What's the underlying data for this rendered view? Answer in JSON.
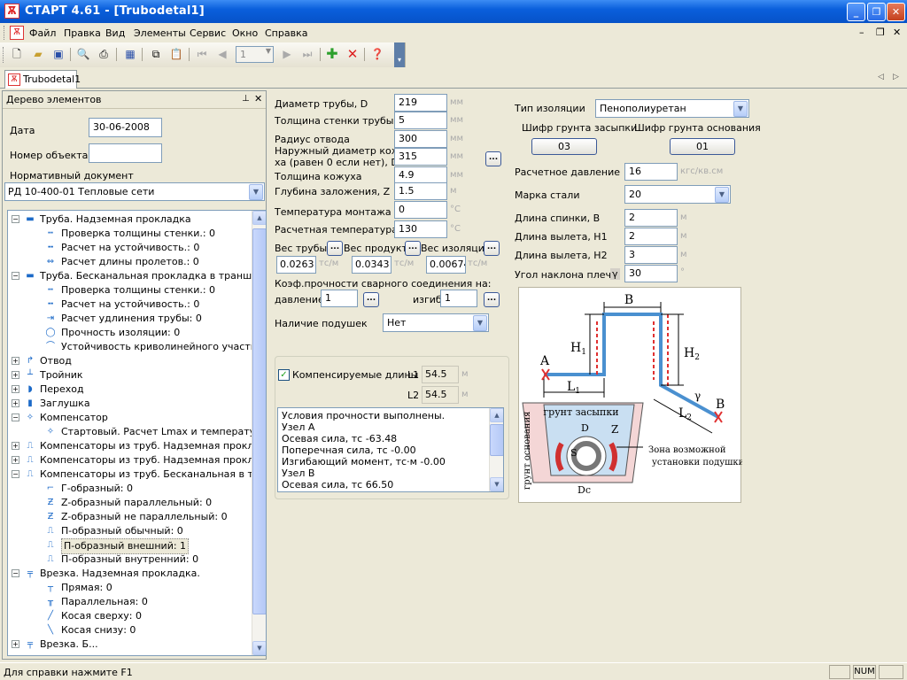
{
  "window": {
    "title": "СТАРТ 4.61 - [Trubodetal1]",
    "app_icon_glyph": "Ѫ"
  },
  "menu": [
    "Файл",
    "Правка",
    "Вид",
    "Элементы",
    "Сервис",
    "Окно",
    "Справка"
  ],
  "toolbar": {
    "page_value": "1"
  },
  "doc_tab": "Trubodetal1",
  "panel": {
    "title": "Дерево элементов",
    "date_label": "Дата",
    "date_value": "30-06-2008",
    "object_label": "Номер объекта",
    "object_value": "",
    "norm_label": "Нормативный документ",
    "norm_value": "РД 10-400-01 Тепловые сети"
  },
  "tree": [
    {
      "level": 0,
      "exp": "−",
      "icon": "▬",
      "text": "Труба. Надземная прокладка"
    },
    {
      "level": 1,
      "icon": "┅",
      "text": "Проверка толщины стенки.: 0"
    },
    {
      "level": 1,
      "icon": "╍",
      "text": "Расчет на устойчивость.: 0"
    },
    {
      "level": 1,
      "icon": "⇔",
      "text": "Расчет длины пролетов.: 0"
    },
    {
      "level": 0,
      "exp": "−",
      "icon": "▬",
      "text": "Труба. Бесканальная прокладка в траншее"
    },
    {
      "level": 1,
      "icon": "┅",
      "text": "Проверка толщины стенки.: 0"
    },
    {
      "level": 1,
      "icon": "╍",
      "text": "Расчет на устойчивость.: 0"
    },
    {
      "level": 1,
      "icon": "⇥",
      "text": "Расчет удлинения трубы: 0"
    },
    {
      "level": 1,
      "icon": "◯",
      "text": "Прочность изоляции: 0"
    },
    {
      "level": 1,
      "icon": "⌒",
      "text": "Устойчивость криволинейного участка: 0"
    },
    {
      "level": 0,
      "exp": "+",
      "icon": "↱",
      "text": "Отвод"
    },
    {
      "level": 0,
      "exp": "+",
      "icon": "┴",
      "text": "Тройник"
    },
    {
      "level": 0,
      "exp": "+",
      "icon": "◗",
      "text": "Переход"
    },
    {
      "level": 0,
      "exp": "+",
      "icon": "▮",
      "text": "Заглушка"
    },
    {
      "level": 0,
      "exp": "−",
      "icon": "✧",
      "text": "Компенсатор"
    },
    {
      "level": 1,
      "icon": "✧",
      "text": "Стартовый. Расчет Lmax и температуры з"
    },
    {
      "level": 0,
      "exp": "+",
      "icon": "⎍",
      "text": "Компенсаторы из труб. Надземная прокладк"
    },
    {
      "level": 0,
      "exp": "+",
      "icon": "⎍",
      "text": "Компенсаторы из труб. Надземная прокладк"
    },
    {
      "level": 0,
      "exp": "−",
      "icon": "⎍",
      "text": "Компенсаторы из труб. Бесканальная в транш"
    },
    {
      "level": 1,
      "icon": "⌐",
      "text": "Г-образный: 0"
    },
    {
      "level": 1,
      "icon": "Ƶ",
      "text": "Z-образный параллельный: 0"
    },
    {
      "level": 1,
      "icon": "Ƶ",
      "text": "Z-образный не параллельный: 0"
    },
    {
      "level": 1,
      "icon": "⎍",
      "text": "П-образный обычный: 0"
    },
    {
      "level": 1,
      "icon": "⎍",
      "text": "П-образный внешний: 1",
      "selected": true
    },
    {
      "level": 1,
      "icon": "⎍",
      "text": "П-образный внутренний: 0"
    },
    {
      "level": 0,
      "exp": "−",
      "icon": "╤",
      "text": "Врезка. Надземная прокладка."
    },
    {
      "level": 1,
      "icon": "┬",
      "text": "Прямая: 0"
    },
    {
      "level": 1,
      "icon": "╥",
      "text": "Параллельная: 0"
    },
    {
      "level": 1,
      "icon": "╱",
      "text": "Косая сверху: 0"
    },
    {
      "level": 1,
      "icon": "╲",
      "text": "Косая снизу: 0"
    },
    {
      "level": 0,
      "exp": "+",
      "icon": "╤",
      "text": "Врезка. Б..."
    }
  ],
  "form": {
    "diameter": {
      "label": "Диаметр трубы, D",
      "value": "219",
      "unit": "мм"
    },
    "wall": {
      "label": "Толщина стенки трубы, S",
      "value": "5",
      "unit": "мм"
    },
    "bend_radius": {
      "label": "Радиус отвода",
      "value": "300",
      "unit": "мм"
    },
    "outer_diam": {
      "label1": "Наружный диаметр кожу-",
      "label2": "ха (равен 0 если нет), Dc",
      "value": "315",
      "unit": "мм"
    },
    "casing": {
      "label": "Толщина кожуха",
      "value": "4.9",
      "unit": "мм"
    },
    "depth": {
      "label": "Глубина заложения, Z",
      "value": "1.5",
      "unit": "м"
    },
    "install_temp": {
      "label": "Температура монтажа",
      "value": "0",
      "unit": "°C"
    },
    "calc_temp": {
      "label": "Расчетная температура",
      "value": "130",
      "unit": "°C"
    },
    "weights": {
      "pipe_label": "Вес трубы",
      "product_label": "Вес продукта",
      "insul_label": "Вес изоляции",
      "pipe": "0.0263",
      "product": "0.0343",
      "insul": "0.00674",
      "unit": "тс/м"
    },
    "weld_label": "Коэф.прочности сварного соединения на:",
    "pressure_label": "давление",
    "pressure_value": "1",
    "bend_label": "изгиб",
    "bend_value": "1",
    "cushions_label": "Наличие подушек",
    "cushions_value": "Нет",
    "comp_label": "Компенсируемые длины",
    "comp_checked": true,
    "l1_label": "L1",
    "l1_value": "54.5",
    "l2_label": "L2",
    "l2_value": "54.5",
    "l_unit": "м"
  },
  "results": [
    "Условия прочности выполнены.",
    "Узел A",
    "Осевая сила, тс  -63.48",
    "Поперечная сила, тс  -0.00",
    "Изгибающий момент, тс·м  -0.00",
    "Узел B",
    "Осевая сила, тс  66.50"
  ],
  "right": {
    "insul_type_label": "Тип изоляции",
    "insul_type_value": "Пенополиуретан",
    "backfill_label": "Шифр грунта засыпки",
    "backfill_code": "03",
    "base_label": "Шифр грунта основания",
    "base_code": "01",
    "pressure_label": "Расчетное давление",
    "pressure_value": "16",
    "pressure_unit": "кгс/кв.см",
    "steel_label": "Марка стали",
    "steel_value": "20",
    "back_label": "Длина спинки, B",
    "back_value": "2",
    "back_unit": "м",
    "h1_label": "Длина вылета, H1",
    "h1_value": "2",
    "h1_unit": "м",
    "h2_label": "Длина вылета, H2",
    "h2_value": "3",
    "h2_unit": "м",
    "angle_label": "Угол наклона плеча,",
    "angle_symbol": "γ",
    "angle_value": "30",
    "angle_unit": "°"
  },
  "diagram": {
    "B": "B",
    "H1": "H",
    "H1sub": "1",
    "H2": "H",
    "H2sub": "2",
    "A": "A",
    "Bnode": "B",
    "L1": "L",
    "L1sub": "1",
    "L2": "L",
    "L2sub": "2",
    "gamma": "γ",
    "backfill": "грунт засыпки",
    "base": "грунт основания",
    "D": "D",
    "Z": "Z",
    "S": "S",
    "Dc": "Dc",
    "zone1": "Зона возможной",
    "zone2": "установки подушки"
  },
  "status": {
    "text": "Для справки нажмите F1",
    "num": "NUM"
  }
}
